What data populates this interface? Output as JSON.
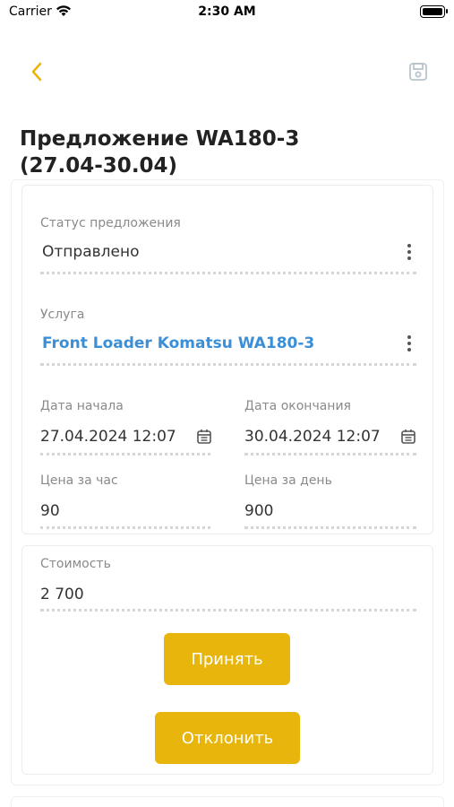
{
  "status_bar": {
    "carrier": "Carrier",
    "time": "2:30 AM"
  },
  "nav": {
    "back_icon": "chevron-left-icon",
    "save_icon": "save-icon",
    "accent_color": "#e8b50c"
  },
  "title": "Предложение WA180-3\n(27.04-30.04)",
  "title_line1": "Предложение WA180-3",
  "title_line2": "(27.04-30.04)",
  "form": {
    "status": {
      "label": "Статус предложения",
      "value": "Отправлено"
    },
    "service": {
      "label": "Услуга",
      "value": "Front Loader Komatsu WA180-3",
      "color": "#3a8fd6"
    },
    "start_date": {
      "label": "Дата начала",
      "value": "27.04.2024 12:07"
    },
    "end_date": {
      "label": "Дата окончания",
      "value": "30.04.2024 12:07"
    },
    "price_hour": {
      "label": "Цена за час",
      "value": "90"
    },
    "price_day": {
      "label": "Цена за день",
      "value": "900"
    }
  },
  "cost": {
    "label": "Стоимость",
    "value": "2 700"
  },
  "actions": {
    "accept": "Принять",
    "decline": "Отклонить",
    "button_color": "#e8b50c"
  }
}
